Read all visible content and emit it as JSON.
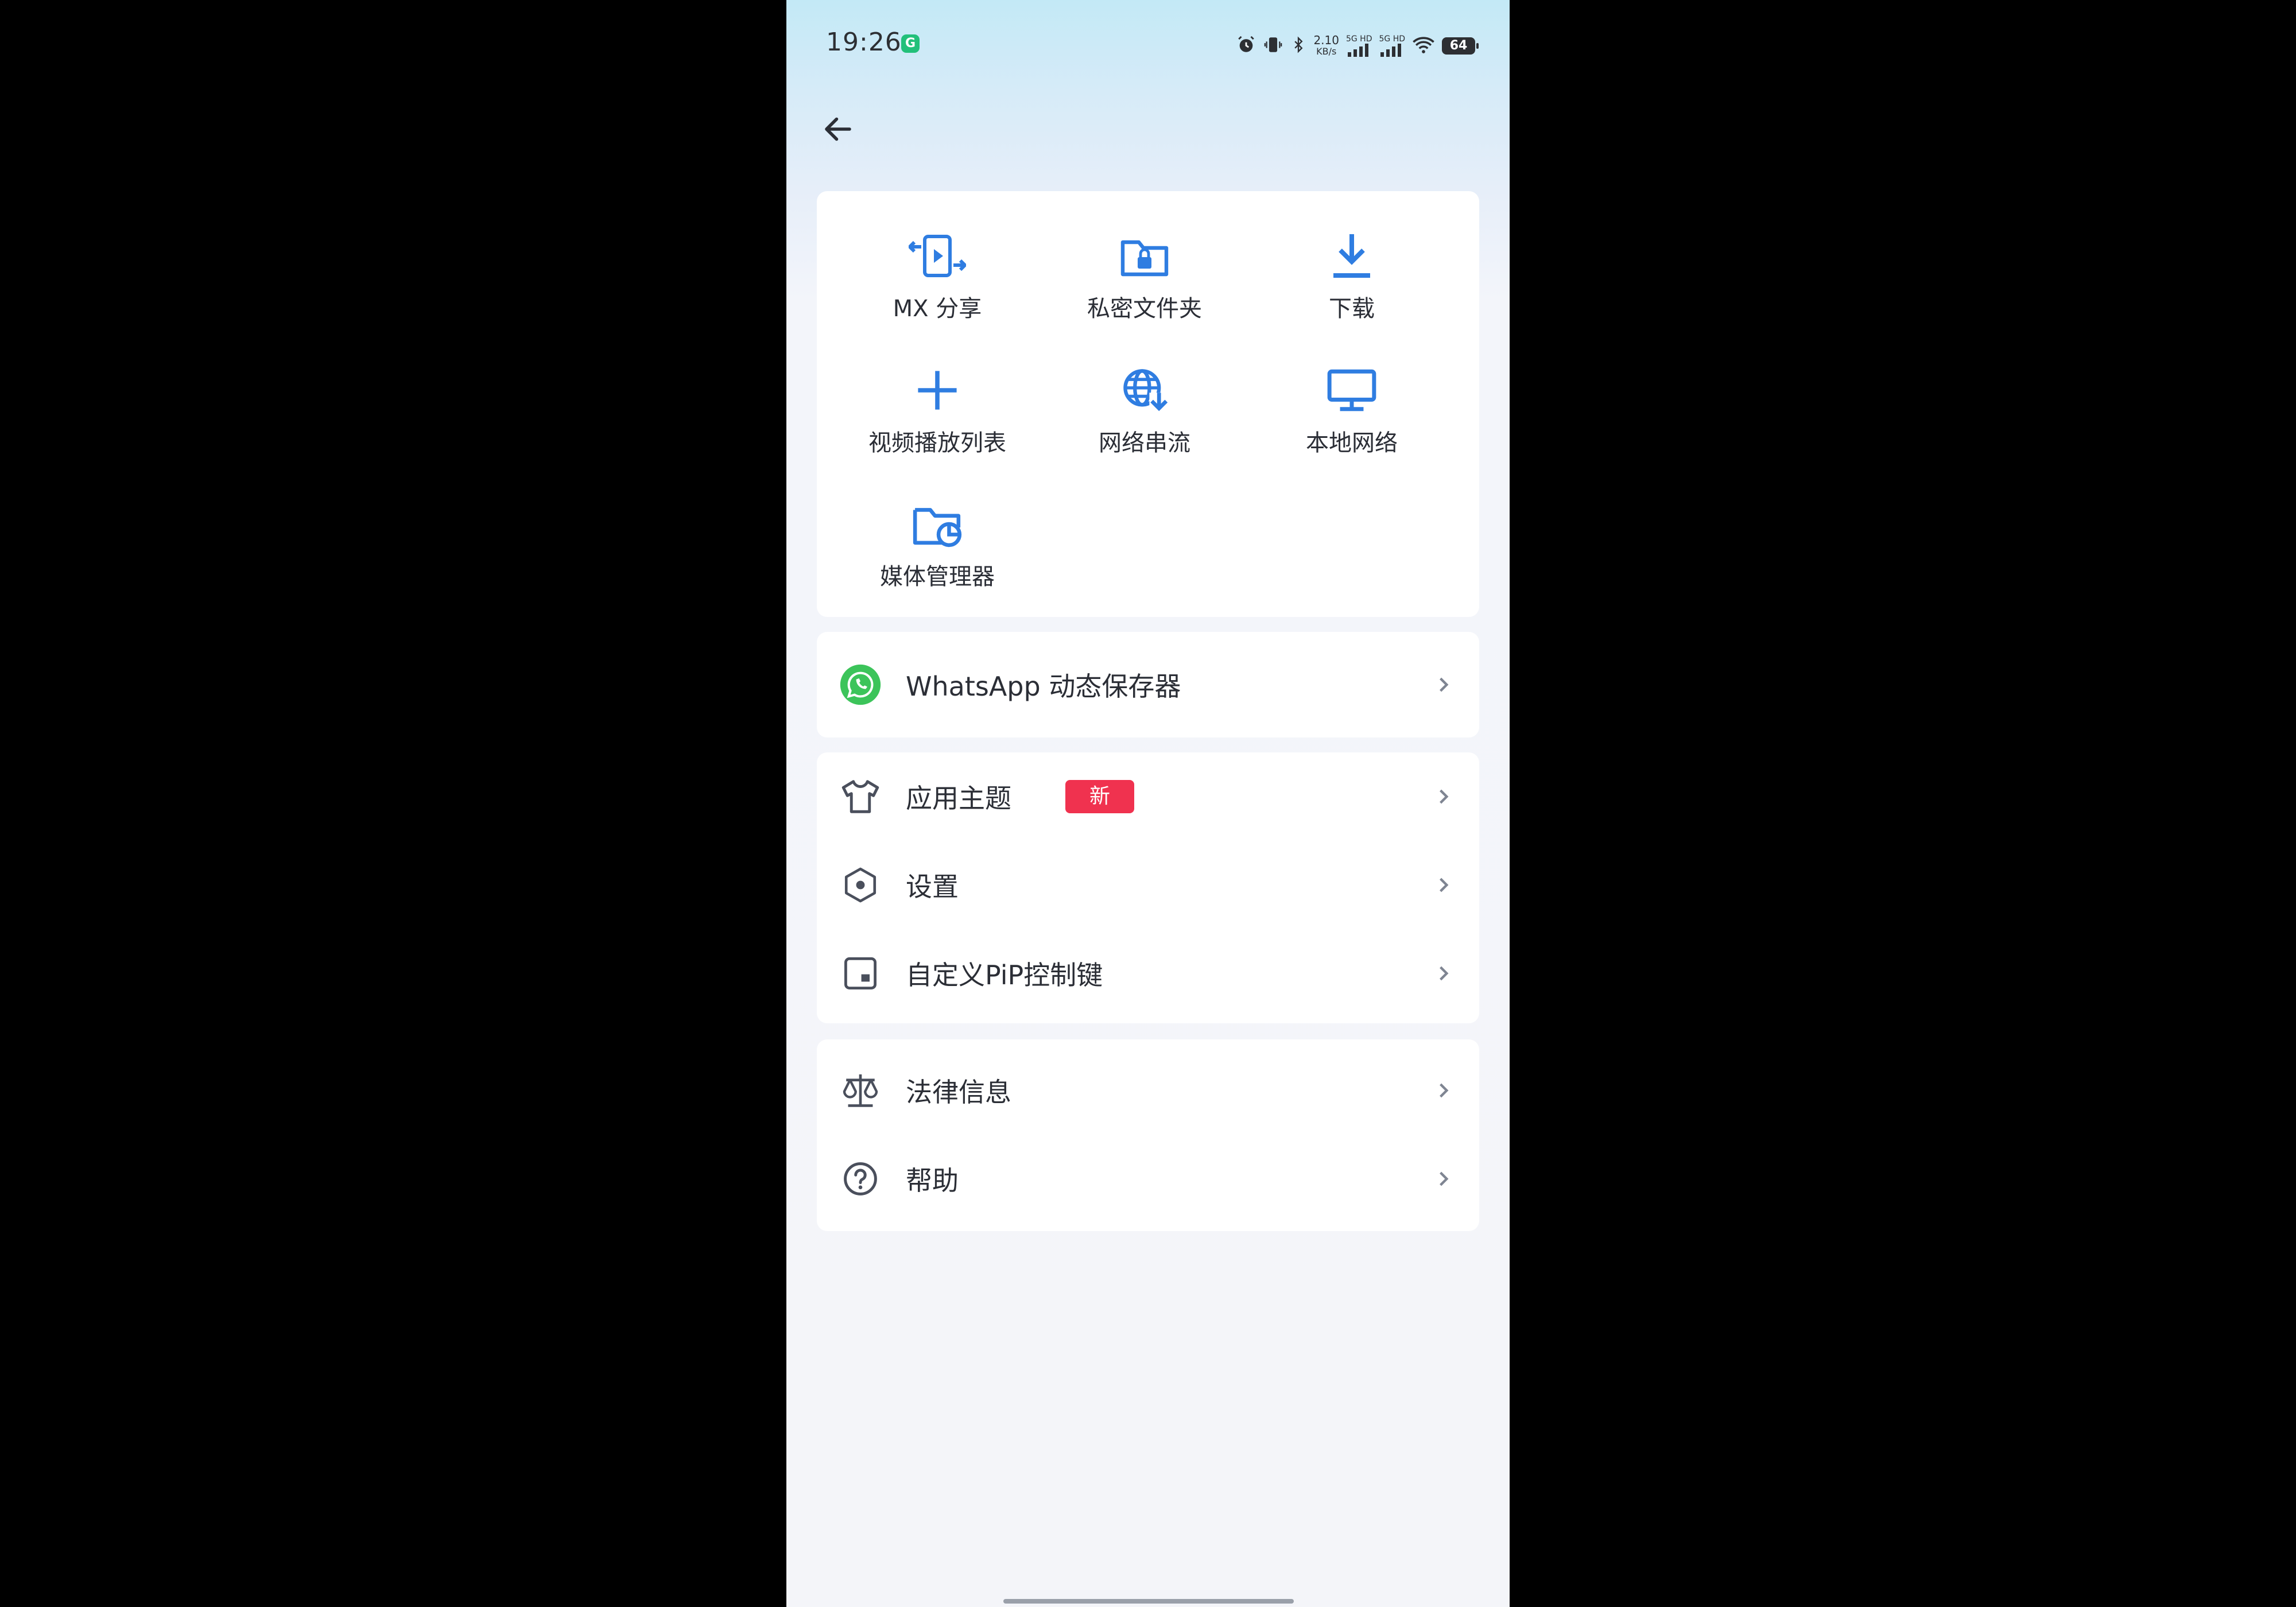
{
  "status_bar": {
    "time": "19:26",
    "speed_value": "2.10",
    "speed_unit": "KB/s",
    "net1": "5G HD",
    "net2": "5G HD",
    "battery": "64"
  },
  "shortcuts": [
    {
      "label": "MX 分享",
      "icon": "mx-share-icon"
    },
    {
      "label": "私密文件夹",
      "icon": "private-folder-icon"
    },
    {
      "label": "下载",
      "icon": "download-icon"
    },
    {
      "label": "视频播放列表",
      "icon": "plus-icon"
    },
    {
      "label": "网络串流",
      "icon": "network-stream-icon"
    },
    {
      "label": "本地网络",
      "icon": "local-network-icon"
    },
    {
      "label": "媒体管理器",
      "icon": "media-manager-icon"
    }
  ],
  "whatsapp": {
    "label": "WhatsApp 动态保存器"
  },
  "settings_items": [
    {
      "label": "应用主题",
      "badge": "新",
      "icon": "tshirt-icon"
    },
    {
      "label": "设置",
      "icon": "hexagon-settings-icon"
    },
    {
      "label": "自定义PiP控制键",
      "icon": "pip-icon"
    }
  ],
  "info_items": [
    {
      "label": "法律信息",
      "icon": "scales-icon"
    },
    {
      "label": "帮助",
      "icon": "help-icon"
    }
  ],
  "colors": {
    "accent": "#2f7de1",
    "badge": "#f0324f",
    "whatsapp": "#3cc45a",
    "text": "#2b2e36",
    "icon_gray": "#4a4f5c"
  }
}
